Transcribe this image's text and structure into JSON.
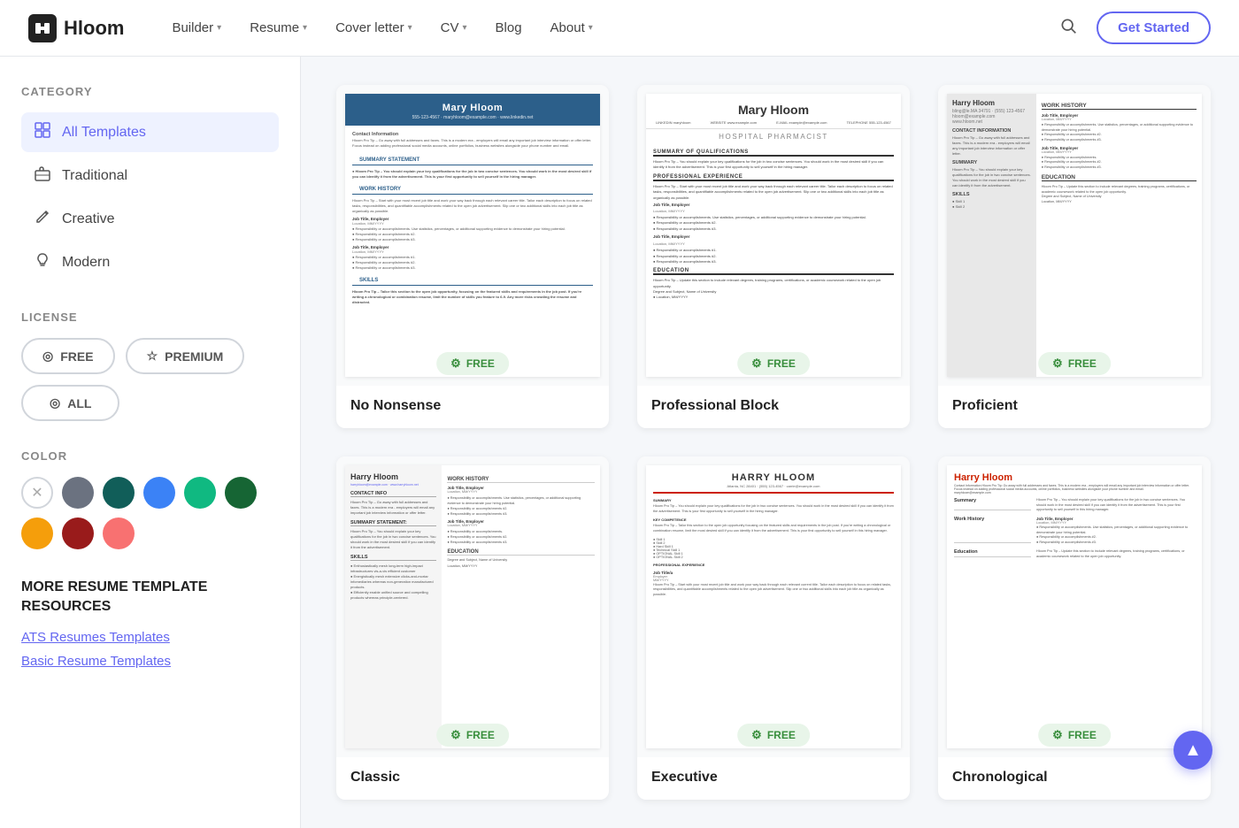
{
  "header": {
    "logo_text": "Hloom",
    "logo_icon": "h",
    "nav_items": [
      {
        "label": "Builder",
        "has_dropdown": true
      },
      {
        "label": "Resume",
        "has_dropdown": true
      },
      {
        "label": "Cover letter",
        "has_dropdown": true
      },
      {
        "label": "CV",
        "has_dropdown": true
      },
      {
        "label": "Blog",
        "has_dropdown": false
      },
      {
        "label": "About",
        "has_dropdown": true
      }
    ],
    "cta_label": "Get Started"
  },
  "sidebar": {
    "category_title": "CATEGORY",
    "categories": [
      {
        "id": "all",
        "label": "All Templates",
        "icon": "⊞",
        "active": true
      },
      {
        "id": "traditional",
        "label": "Traditional",
        "icon": "💼",
        "active": false
      },
      {
        "id": "creative",
        "label": "Creative",
        "icon": "✏️",
        "active": false
      },
      {
        "id": "modern",
        "label": "Modern",
        "icon": "💡",
        "active": false
      }
    ],
    "license_title": "LICENSE",
    "license_options": [
      {
        "id": "free",
        "label": "FREE",
        "icon": "◎"
      },
      {
        "id": "premium",
        "label": "PREMIUM",
        "icon": "☆"
      }
    ],
    "license_all_label": "ALL",
    "color_title": "COLOR",
    "colors": [
      {
        "id": "none",
        "value": "none",
        "label": "None"
      },
      {
        "id": "gray",
        "value": "#6b7280",
        "label": "Gray"
      },
      {
        "id": "teal",
        "value": "#115e59",
        "label": "Dark Teal"
      },
      {
        "id": "blue",
        "value": "#3b82f6",
        "label": "Blue"
      },
      {
        "id": "green",
        "value": "#10b981",
        "label": "Green"
      },
      {
        "id": "dark-green",
        "value": "#166534",
        "label": "Dark Green"
      },
      {
        "id": "yellow",
        "value": "#f59e0b",
        "label": "Yellow"
      },
      {
        "id": "red",
        "value": "#991b1b",
        "label": "Dark Red"
      },
      {
        "id": "salmon",
        "value": "#f87171",
        "label": "Salmon"
      }
    ],
    "more_resources_title": "MORE RESUME TEMPLATE RESOURCES",
    "resource_links": [
      {
        "label": "ATS Resumes Templates"
      },
      {
        "label": "Basic Resume Templates"
      }
    ]
  },
  "main": {
    "templates": [
      {
        "id": "no-nonsense",
        "name": "No Nonsense",
        "badge": "FREE",
        "person_name": "Mary Hloom",
        "style": "blue-header"
      },
      {
        "id": "professional-block",
        "name": "Professional Block",
        "badge": "FREE",
        "person_name": "Mary Hloom",
        "style": "professional"
      },
      {
        "id": "proficient",
        "name": "Proficient",
        "badge": "FREE",
        "person_name": "Harry Hloom",
        "style": "proficient"
      },
      {
        "id": "template-4",
        "name": "Classic",
        "badge": "FREE",
        "person_name": "Harry Hloom",
        "style": "two-col"
      },
      {
        "id": "template-5",
        "name": "Executive",
        "badge": "FREE",
        "person_name": "Harry Hloom",
        "style": "red-header"
      },
      {
        "id": "template-6",
        "name": "Chronological",
        "badge": "FREE",
        "person_name": "Harry Hloom",
        "style": "center"
      }
    ]
  },
  "scroll_up_icon": "▲"
}
